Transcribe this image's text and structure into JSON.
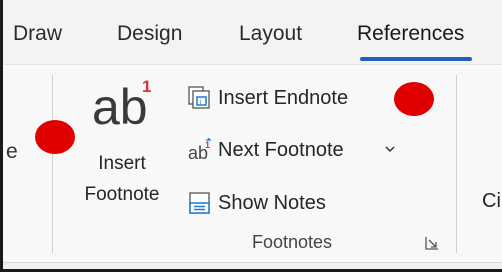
{
  "tabs": [
    {
      "label": "Draw",
      "active": false
    },
    {
      "label": "Design",
      "active": false
    },
    {
      "label": "Layout",
      "active": false
    },
    {
      "label": "References",
      "active": true
    }
  ],
  "ribbon": {
    "clipped_left_text": "e",
    "insert_footnote": {
      "icon_text": "ab",
      "icon_superscript": "1",
      "label_line1": "Insert",
      "label_line2": "Footnote"
    },
    "insert_endnote": {
      "label": "Insert Endnote",
      "icon": "endnote-icon"
    },
    "next_footnote": {
      "label": "Next Footnote",
      "icon": "next-footnote-icon",
      "dropdown": "chevron-down-icon"
    },
    "show_notes": {
      "label": "Show Notes",
      "icon": "show-notes-icon"
    },
    "group_label": "Footnotes",
    "clipped_right_text": "Ci"
  },
  "colors": {
    "accent_blue": "#1f5fbf",
    "annotation_red": "#e00000",
    "superscript_red": "#d9343b"
  }
}
